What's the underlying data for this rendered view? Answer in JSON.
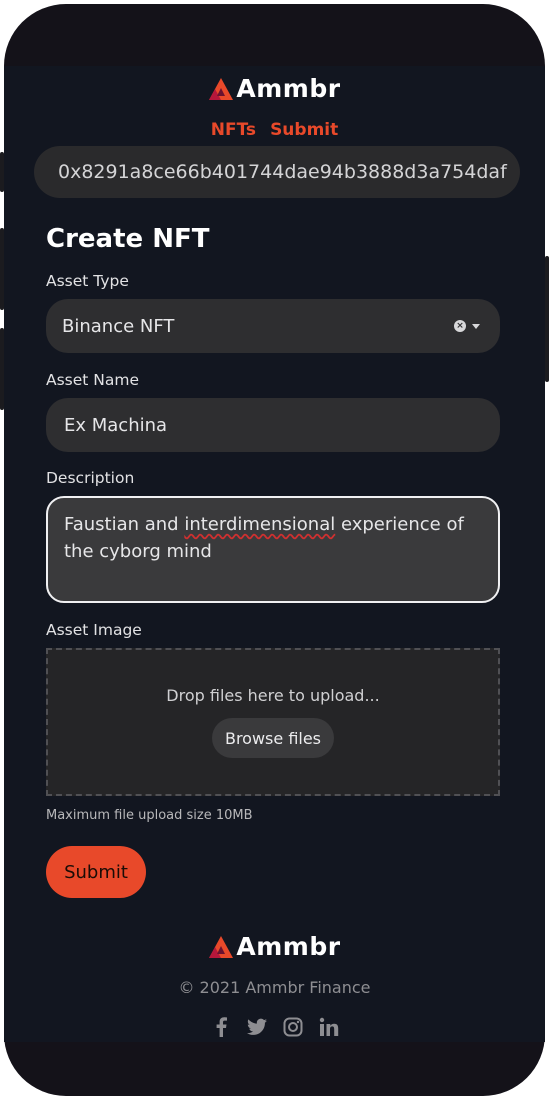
{
  "brand": {
    "name": "Ammbr",
    "accent": "#e8492a"
  },
  "nav": {
    "items": [
      "NFTs",
      "Submit"
    ]
  },
  "wallet": {
    "address": "0x8291a8ce66b401744dae94b3888d3a754daf"
  },
  "form": {
    "title": "Create NFT",
    "asset_type": {
      "label": "Asset Type",
      "value": "Binance NFT"
    },
    "asset_name": {
      "label": "Asset Name",
      "value": "Ex Machina"
    },
    "description": {
      "label": "Description",
      "value_prefix": "Faustian and ",
      "value_misspelled": "interdimensional",
      "value_suffix": " experience of the cyborg mind"
    },
    "asset_image": {
      "label": "Asset Image",
      "drop_text": "Drop files here to upload...",
      "browse_label": "Browse files",
      "hint": "Maximum file upload size 10MB"
    },
    "submit_label": "Submit"
  },
  "footer": {
    "brand": "Ammbr",
    "copyright": "© 2021 Ammbr Finance",
    "social_icons": [
      "facebook-icon",
      "twitter-icon",
      "instagram-icon",
      "linkedin-icon"
    ]
  }
}
